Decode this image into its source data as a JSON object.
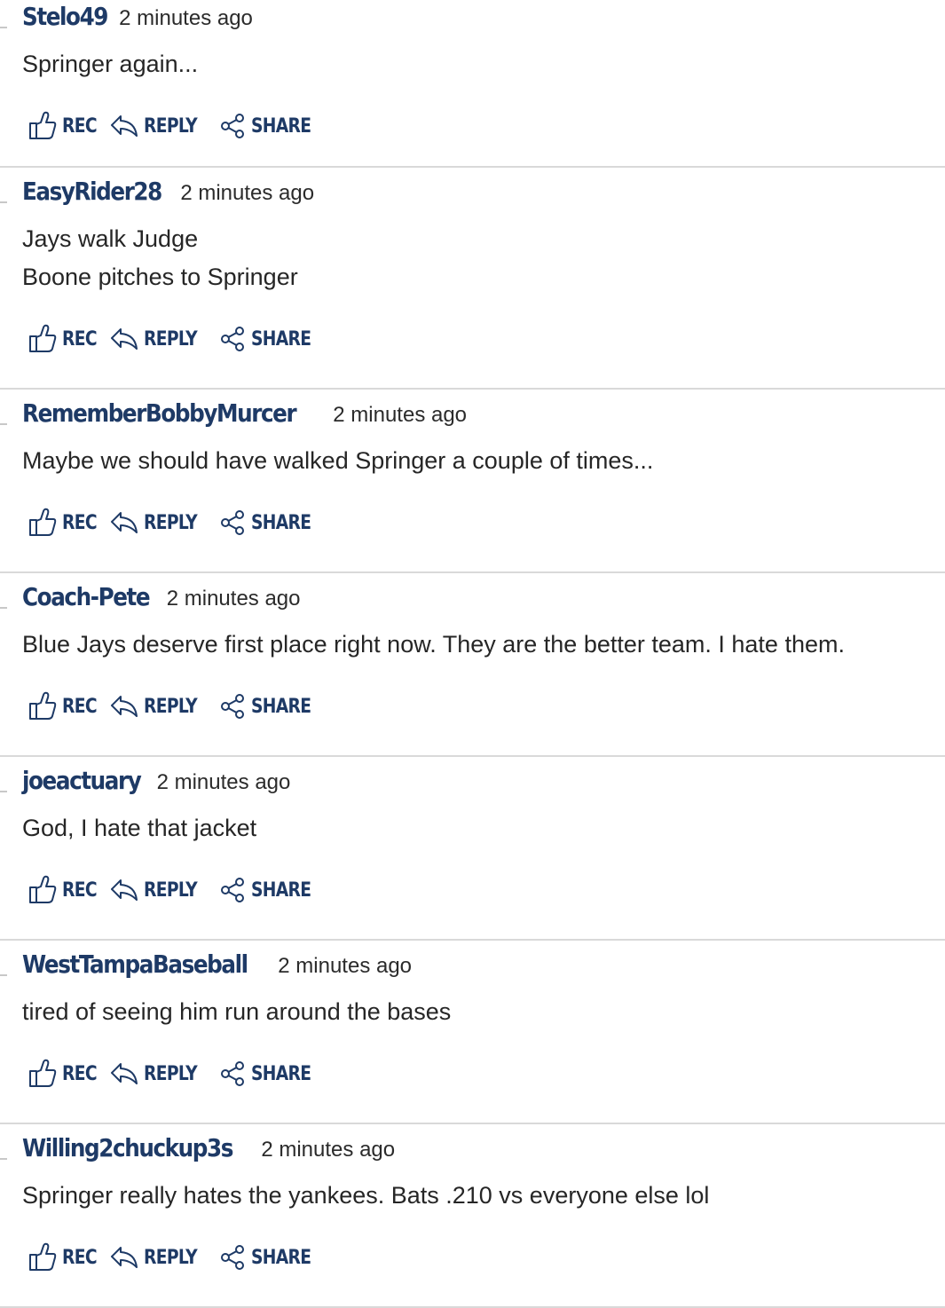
{
  "labels": {
    "rec": "REC",
    "reply": "REPLY",
    "share": "SHARE"
  },
  "colors": {
    "accent": "#1e3a66",
    "divider": "#d9d9d9",
    "text": "#262626"
  },
  "comments": [
    {
      "author": "Stelo49",
      "time": "2 minutes ago",
      "lines": [
        "Springer again..."
      ]
    },
    {
      "author": "EasyRider28",
      "time": "2 minutes ago",
      "lines": [
        "Jays walk Judge",
        "Boone pitches to Springer"
      ]
    },
    {
      "author": "RememberBobbyMurcer",
      "time": "2 minutes ago",
      "lines": [
        "Maybe we should have walked Springer a couple of times..."
      ]
    },
    {
      "author": "Coach-Pete",
      "time": "2 minutes ago",
      "lines": [
        "Blue Jays deserve first place right now. They are the better team. I hate them."
      ]
    },
    {
      "author": "joeactuary",
      "time": "2 minutes ago",
      "lines": [
        "God, I hate that jacket"
      ]
    },
    {
      "author": "WestTampaBaseball",
      "time": "2 minutes ago",
      "lines": [
        "tired of seeing him run around the bases"
      ]
    },
    {
      "author": "Willing2chuckup3s",
      "time": "2 minutes ago",
      "lines": [
        "Springer really hates the yankees. Bats .210 vs everyone else lol"
      ]
    }
  ]
}
